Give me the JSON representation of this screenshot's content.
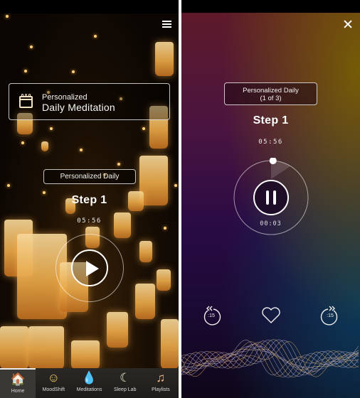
{
  "left_screen": {
    "menu_icon": "hamburger-menu-icon",
    "daily_card": {
      "icon": "calendar-icon",
      "line1": "Personalized",
      "line2": "Daily Meditation"
    },
    "session_pill": "Personalized Daily",
    "step_label": "Step 1",
    "duration": "05:56",
    "play_icon": "play-icon",
    "tabs": [
      {
        "label": "Home",
        "icon": "🏠",
        "active": true
      },
      {
        "label": "MoodShift",
        "icon": "☺",
        "active": false
      },
      {
        "label": "Meditations",
        "icon": "💧",
        "active": false
      },
      {
        "label": "Sleep Lab",
        "icon": "☾",
        "active": false
      },
      {
        "label": "Playlists",
        "icon": "♫",
        "active": false
      }
    ]
  },
  "right_screen": {
    "close_icon": "close-icon",
    "session_pill_line1": "Personalized Daily",
    "session_pill_line2": "(1 of 3)",
    "step_label": "Step 1",
    "duration": "05:56",
    "elapsed": "00:03",
    "progress_fraction": 0.0084,
    "pause_icon": "pause-icon",
    "rewind_label": ":15",
    "forward_label": ":15",
    "favorite_icon": "heart-icon"
  }
}
